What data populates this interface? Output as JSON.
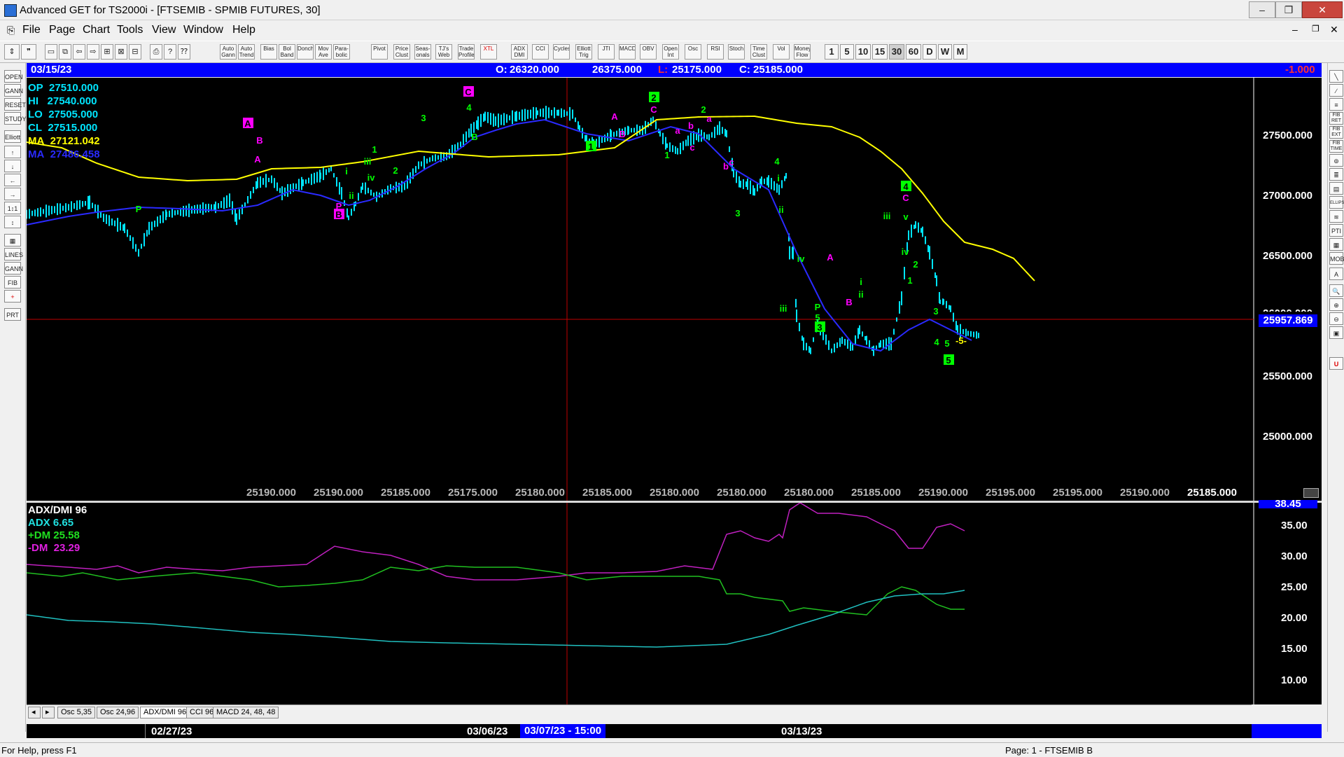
{
  "window": {
    "title": "Advanced GET for TS2000i - [FTSEMIB - SPMIB FUTURES, 30]",
    "controls": [
      "‒",
      "❐",
      "✕"
    ],
    "child_controls": [
      "‒",
      "❐",
      "✕"
    ]
  },
  "menu": [
    "File",
    "Page",
    "Chart",
    "Tools",
    "View",
    "Window",
    "Help"
  ],
  "toolbar": {
    "study_buttons": [
      "Auto Gann",
      "Auto Trend",
      "Bias",
      "Bol Band",
      "Donch",
      "Mov Ave",
      "Para-bolic",
      "Pivot",
      "Price Clust",
      "Seas-onals",
      "TJ's Web",
      "Trade Profile",
      "XTL",
      "ADX DMI",
      "CCI",
      "Cycles",
      "Elliott Trig",
      "JTI",
      "MACD",
      "OBV",
      "Open Int",
      "Osc",
      "RSI",
      "Stoch",
      "Time Clust",
      "Vol",
      "Money Flow"
    ],
    "periods": [
      "1",
      "5",
      "10",
      "15",
      "30",
      "60",
      "D",
      "W",
      "M"
    ],
    "active_period": "30"
  },
  "left_tools": [
    "OPEN",
    "GANN",
    "RESET",
    "STUDY",
    "Elliott",
    "↑",
    "↓",
    "←",
    "→",
    "1↕1",
    "↕",
    "▦",
    "LINES",
    "GANN",
    "FIB",
    "+",
    "PRT"
  ],
  "right_tools": [
    "╲",
    "∕",
    "≡",
    "FIB RET",
    "FIB EXT",
    "FIB TIME",
    "⊚",
    "≣",
    "▤",
    "ELLIPS",
    "≋",
    "PTI",
    "▦",
    "MOB",
    "A",
    "🔍",
    "⊕",
    "⊖",
    "▣",
    "U"
  ],
  "info_bar": {
    "date": "03/15/23",
    "open_label": "O:",
    "open": "26320.000",
    "high": "26375.000",
    "low_label": "L:",
    "low": "25175.000",
    "close_label": "C:",
    "close": "25185.000",
    "change": "-1.000"
  },
  "cursor_box": {
    "op_label": "OP",
    "op": "27510.000",
    "hi_label": "HI",
    "hi": "27540.000",
    "lo_label": "LO",
    "lo": "27505.000",
    "cl_label": "CL",
    "cl": "27515.000",
    "ma1_label": "MA",
    "ma1": "27121.042",
    "ma2_label": "MA",
    "ma2": "27486.458"
  },
  "price_axis": {
    "ticks": [
      "27500.000",
      "27000.000",
      "26500.000",
      "25500.000",
      "25000.000"
    ],
    "hidden_tick": "26000.000",
    "cursor_label": "25957.869"
  },
  "bottom_prices": [
    "25190.000",
    "25190.000",
    "25185.000",
    "25175.000",
    "25180.000",
    "25185.000",
    "25180.000",
    "25180.000",
    "25180.000",
    "25185.000",
    "25190.000",
    "25195.000",
    "25195.000",
    "25190.000",
    "25185.000"
  ],
  "indicator": {
    "name": "ADX/DMI 96",
    "adx_label": "ADX",
    "adx": "6.65",
    "pdm_label": "+DM",
    "pdm": "25.58",
    "mdm_label": "-DM",
    "mdm": "23.29",
    "axis_ticks": [
      "35.00",
      "30.00",
      "25.00",
      "20.00",
      "15.00",
      "10.00"
    ],
    "top_tick": "38.45"
  },
  "tabs": [
    "Osc 5,35",
    "Osc 24,96",
    "ADX/DMI 96",
    "CCI 96",
    "MACD 24, 48, 48"
  ],
  "active_tab": "ADX/DMI 96",
  "dates": [
    "02/27/23",
    "03/06/23",
    "03/13/23"
  ],
  "cursor_date": "03/07/23 - 15:00",
  "status": {
    "left": "For Help, press F1",
    "right": "Page: 1 - FTSEMIB B"
  },
  "elliott_labels": [
    {
      "t": "P",
      "c": "#00ff00"
    },
    {
      "t": "A",
      "c": "#ff00ff",
      "box": true
    },
    {
      "t": "B",
      "c": "#ff00ff"
    },
    {
      "t": "A",
      "c": "#ff00ff"
    },
    {
      "t": "P",
      "c": "#ff00ff"
    },
    {
      "t": "B",
      "c": "#ff00ff",
      "box": true
    },
    {
      "t": "i",
      "c": "#00ff00"
    },
    {
      "t": "ii",
      "c": "#00ff00"
    },
    {
      "t": "iii",
      "c": "#00ff00"
    },
    {
      "t": "iv",
      "c": "#00ff00"
    },
    {
      "t": "1",
      "c": "#00ff00"
    },
    {
      "t": "2",
      "c": "#00ff00"
    },
    {
      "t": "3",
      "c": "#00ff00"
    },
    {
      "t": "4",
      "c": "#00ff00"
    },
    {
      "t": "C",
      "c": "#ff00ff",
      "box": true
    },
    {
      "t": "B",
      "c": "#00ff00"
    },
    {
      "t": "A",
      "c": "#ff00ff"
    },
    {
      "t": "B",
      "c": "#ff00ff"
    },
    {
      "t": "1",
      "c": "#00ff00",
      "box": true
    },
    {
      "t": "2",
      "c": "#00ff00",
      "box": true
    },
    {
      "t": "C",
      "c": "#ff00ff"
    },
    {
      "t": "a",
      "c": "#ff00ff"
    },
    {
      "t": "b",
      "c": "#ff00ff"
    },
    {
      "t": "c",
      "c": "#ff00ff"
    },
    {
      "t": "1",
      "c": "#00ff00"
    },
    {
      "t": "2",
      "c": "#00ff00"
    },
    {
      "t": "a",
      "c": "#ff00ff"
    },
    {
      "t": "b",
      "c": "#ff00ff"
    },
    {
      "t": "c",
      "c": "#ff00ff"
    },
    {
      "t": "3",
      "c": "#00ff00"
    },
    {
      "t": "4",
      "c": "#00ff00"
    },
    {
      "t": "i",
      "c": "#00ff00"
    },
    {
      "t": "ii",
      "c": "#00ff00"
    },
    {
      "t": "iii",
      "c": "#00ff00"
    },
    {
      "t": "iv",
      "c": "#00ff00"
    },
    {
      "t": "P",
      "c": "#00ff00"
    },
    {
      "t": "5",
      "c": "#00ff00"
    },
    {
      "t": "3",
      "c": "#00ff00",
      "box": true
    },
    {
      "t": "A",
      "c": "#ff00ff"
    },
    {
      "t": "B",
      "c": "#ff00ff"
    },
    {
      "t": "i",
      "c": "#00ff00"
    },
    {
      "t": "ii",
      "c": "#00ff00"
    },
    {
      "t": "iii",
      "c": "#00ff00"
    },
    {
      "t": "v",
      "c": "#00ff00"
    },
    {
      "t": "iv",
      "c": "#00ff00"
    },
    {
      "t": "4",
      "c": "#00ff00",
      "box": true
    },
    {
      "t": "C",
      "c": "#ff00ff"
    },
    {
      "t": "1",
      "c": "#00ff00"
    },
    {
      "t": "2",
      "c": "#00ff00"
    },
    {
      "t": "3",
      "c": "#00ff00"
    },
    {
      "t": "4",
      "c": "#00ff00"
    },
    {
      "t": "5",
      "c": "#00ff00"
    },
    {
      "t": "5",
      "c": "#00ff00",
      "box": true
    },
    {
      "t": "-5-",
      "c": "#ffff00"
    }
  ],
  "colors": {
    "background": "#000000",
    "price_bars": "#00e5ff",
    "ma_fast": "#2a2aff",
    "ma_slow": "#ffff00",
    "adx": "#20c0c0",
    "plus_dm": "#20c020",
    "minus_dm": "#c020c0",
    "info_bar": "#0000ff",
    "cursor_line": "#c00000"
  }
}
